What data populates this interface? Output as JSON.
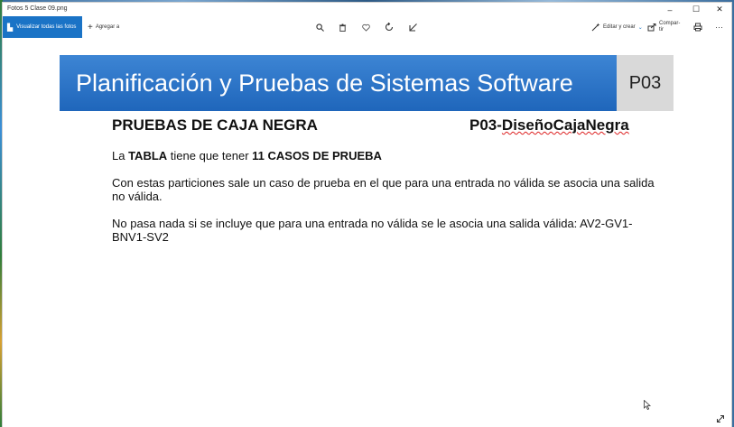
{
  "window": {
    "title": "Fotos 5 Clase 09.png"
  },
  "window_controls": {
    "minimize": "–",
    "maximize": "☐",
    "close": "✕"
  },
  "toolbar": {
    "view_all": "Visualizar todas las fotos",
    "add_to": "Agregar a",
    "edit_create": "Editar y crear",
    "share": "Compar-tir",
    "more": "···"
  },
  "slide": {
    "banner_title": "Planificación y Pruebas de Sistemas Software",
    "code": "P03",
    "heading_left": "PRUEBAS DE CAJA NEGRA",
    "heading_right_prefix": "P03-",
    "heading_right_word": "DiseñoCajaNegra",
    "p1_a": "La ",
    "p1_b": "TABLA",
    "p1_c": " tiene que tener ",
    "p1_d": "11 CASOS DE PRUEBA",
    "p2": "Con estas particiones sale un caso de prueba en el que para una entrada no válida se asocia una salida no válida.",
    "p3": "No pasa nada si se incluye que para una entrada no válida se le asocia una salida válida: AV2-GV1-BNV1-SV2"
  },
  "colors": {
    "accent": "#1a73c6",
    "banner": "#2a72c8",
    "code_box": "#d9d9d9"
  }
}
